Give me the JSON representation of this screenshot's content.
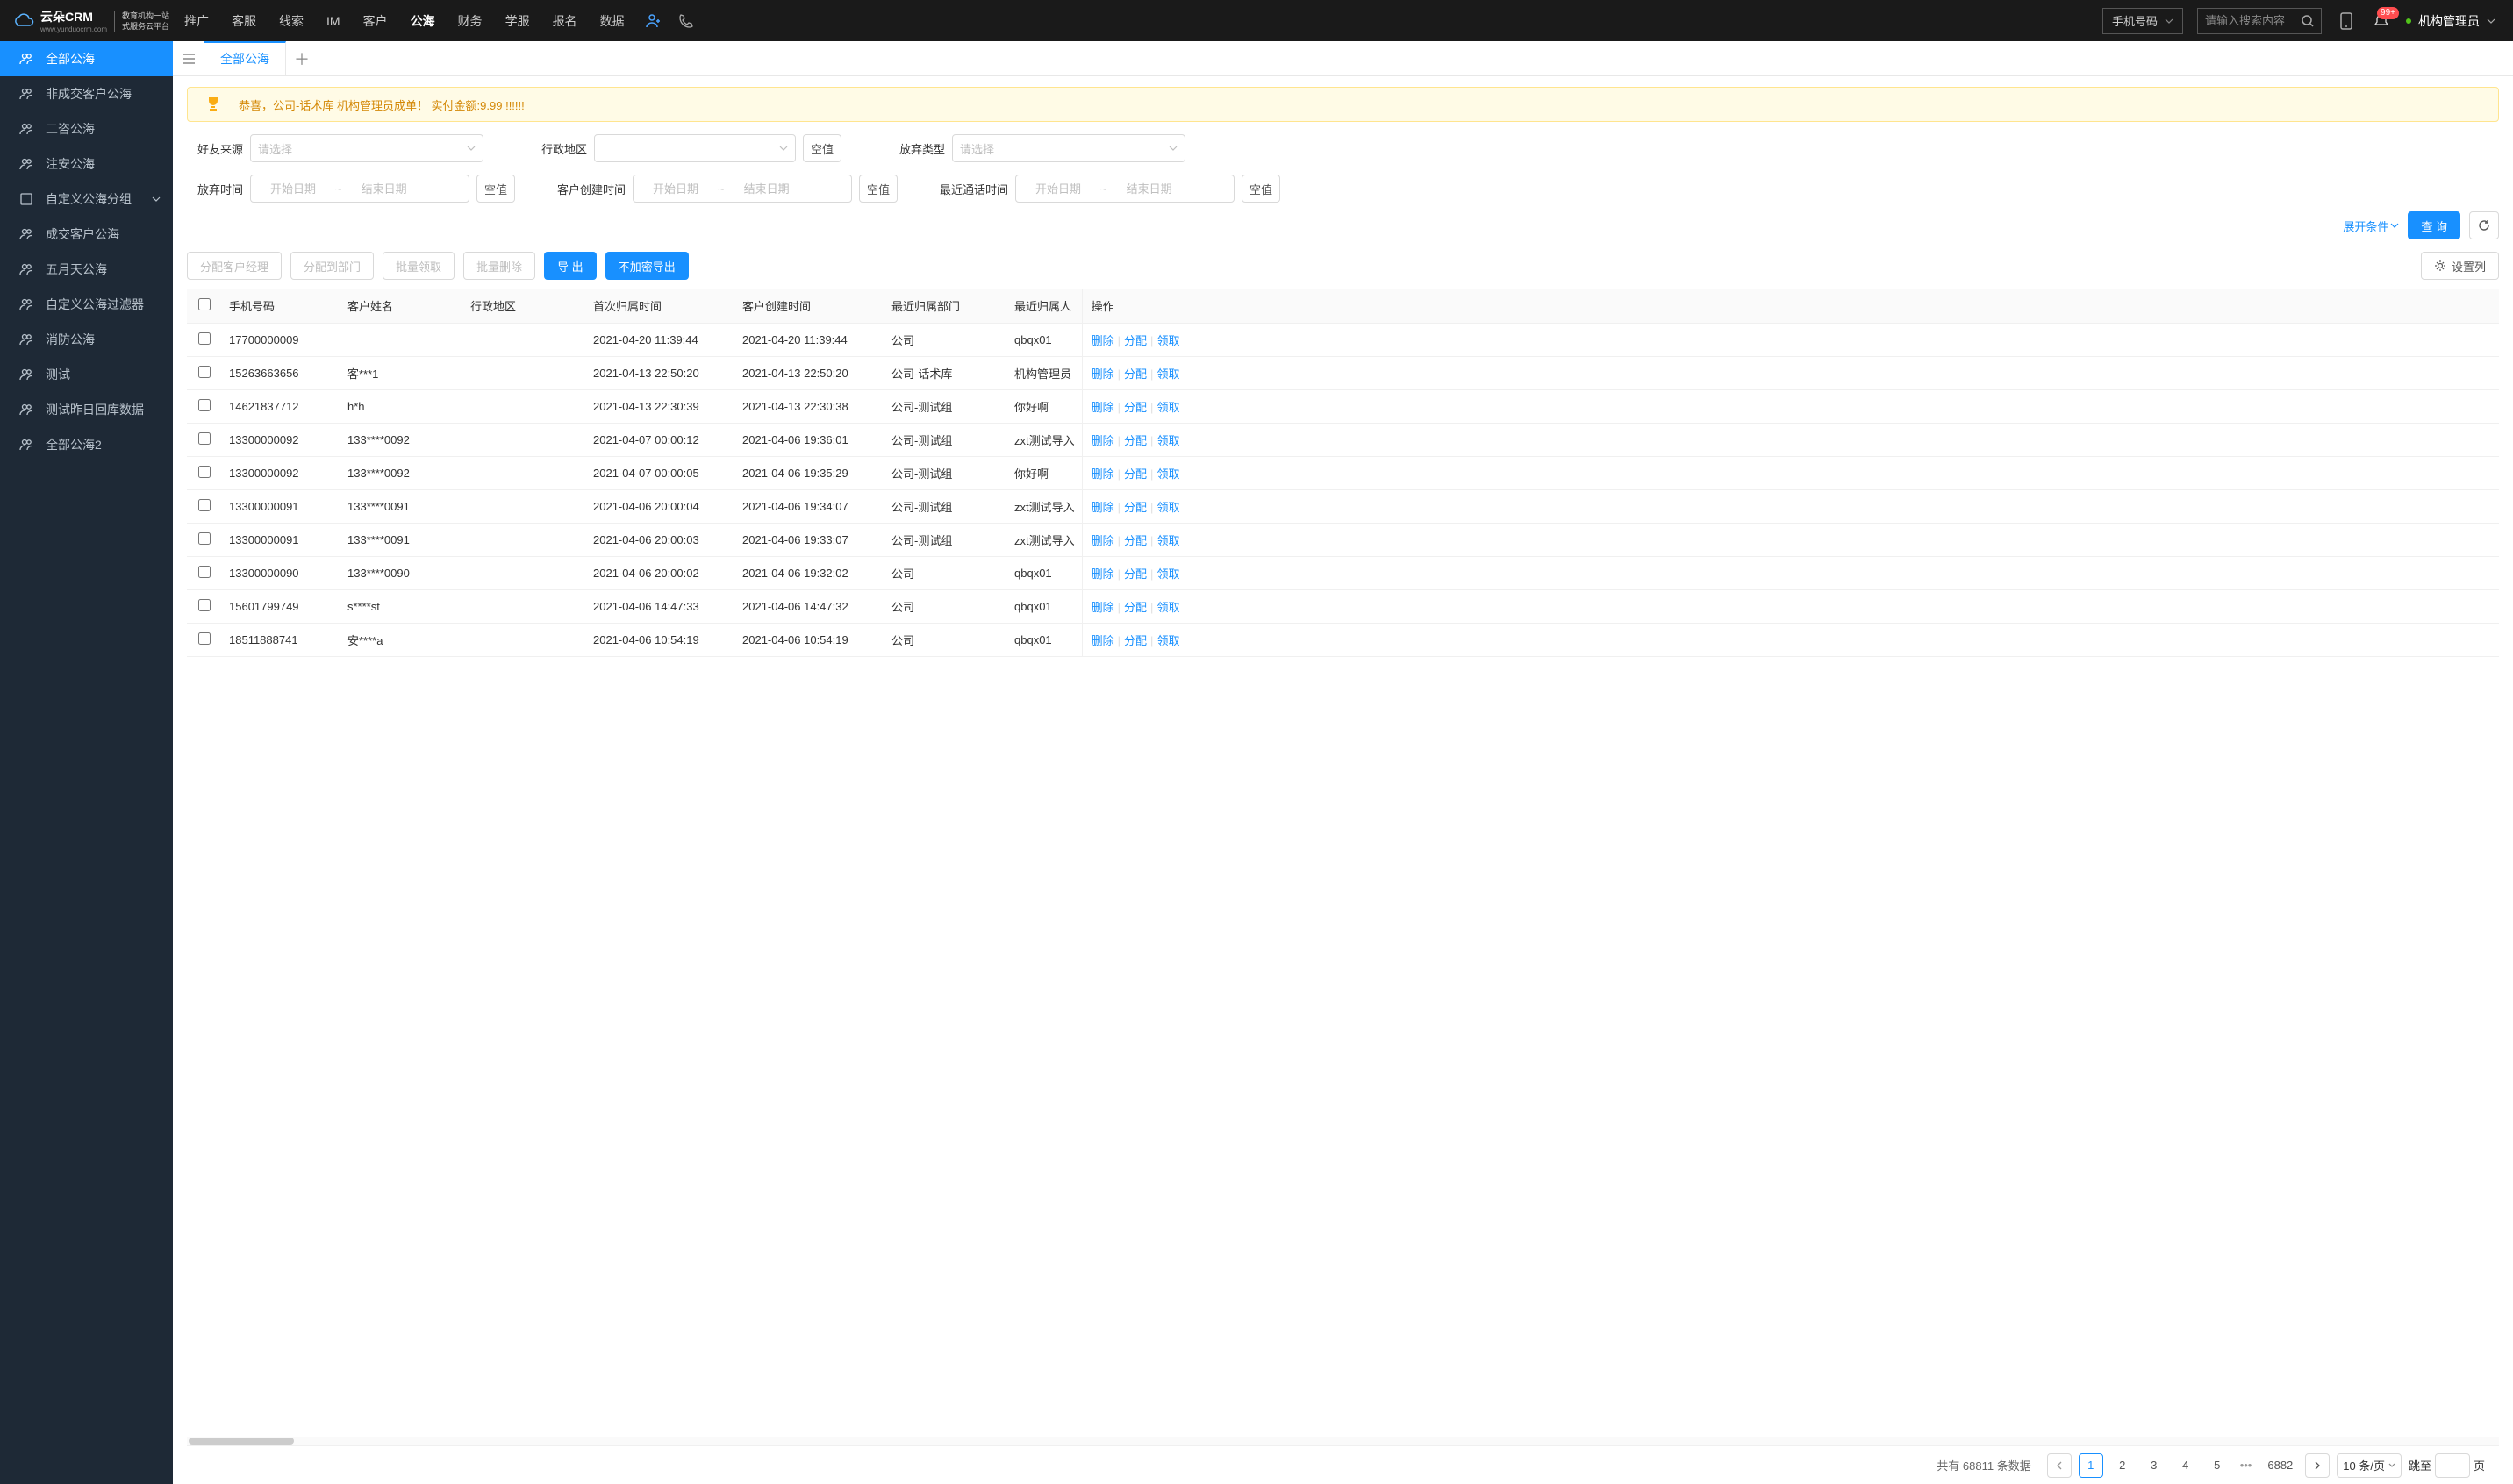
{
  "brand": {
    "name": "云朵CRM",
    "sub1": "教育机构一站",
    "sub2": "式服务云平台",
    "domain": "www.yunduocrm.com"
  },
  "nav": {
    "items": [
      "推广",
      "客服",
      "线索",
      "IM",
      "客户",
      "公海",
      "财务",
      "学服",
      "报名",
      "数据"
    ],
    "active": 5
  },
  "header": {
    "search_type": "手机号码",
    "search_placeholder": "请输入搜索内容",
    "badge": "99+",
    "user": "机构管理员"
  },
  "sidebar": {
    "items": [
      "全部公海",
      "非成交客户公海",
      "二咨公海",
      "注安公海",
      "自定义公海分组",
      "成交客户公海",
      "五月天公海",
      "自定义公海过滤器",
      "消防公海",
      "测试",
      "测试昨日回库数据",
      "全部公海2"
    ],
    "active": 0,
    "has_submenu": 4
  },
  "tabs": {
    "items": [
      "全部公海"
    ],
    "active": 0
  },
  "banner": "恭喜，公司-话术库  机构管理员成单！  实付金额:9.99 !!!!!!",
  "filters": {
    "source_label": "好友来源",
    "region_label": "行政地区",
    "abandon_type_label": "放弃类型",
    "abandon_time_label": "放弃时间",
    "create_time_label": "客户创建时间",
    "last_call_label": "最近通话时间",
    "placeholder_select": "请选择",
    "placeholder_start": "开始日期",
    "placeholder_end": "结束日期",
    "null_btn": "空值",
    "expand": "展开条件",
    "query": "查 询"
  },
  "toolbar": {
    "assign_manager": "分配客户经理",
    "assign_dept": "分配到部门",
    "batch_claim": "批量领取",
    "batch_delete": "批量删除",
    "export": "导 出",
    "export_plain": "不加密导出",
    "set_columns": "设置列"
  },
  "table": {
    "columns": [
      "手机号码",
      "客户姓名",
      "行政地区",
      "首次归属时间",
      "客户创建时间",
      "最近归属部门",
      "最近归属人",
      "操作"
    ],
    "action_labels": {
      "delete": "删除",
      "assign": "分配",
      "claim": "领取"
    },
    "rows": [
      {
        "phone": "17700000009",
        "name": "",
        "region": "",
        "first": "2021-04-20 11:39:44",
        "created": "2021-04-20 11:39:44",
        "dept": "公司",
        "owner": "qbqx01"
      },
      {
        "phone": "15263663656",
        "name": "客***1",
        "region": "",
        "first": "2021-04-13 22:50:20",
        "created": "2021-04-13 22:50:20",
        "dept": "公司-话术库",
        "owner": "机构管理员"
      },
      {
        "phone": "14621837712",
        "name": "h*h",
        "region": "",
        "first": "2021-04-13 22:30:39",
        "created": "2021-04-13 22:30:38",
        "dept": "公司-测试组",
        "owner": "你好啊"
      },
      {
        "phone": "13300000092",
        "name": "133****0092",
        "region": "",
        "first": "2021-04-07 00:00:12",
        "created": "2021-04-06 19:36:01",
        "dept": "公司-测试组",
        "owner": "zxt测试导入"
      },
      {
        "phone": "13300000092",
        "name": "133****0092",
        "region": "",
        "first": "2021-04-07 00:00:05",
        "created": "2021-04-06 19:35:29",
        "dept": "公司-测试组",
        "owner": "你好啊"
      },
      {
        "phone": "13300000091",
        "name": "133****0091",
        "region": "",
        "first": "2021-04-06 20:00:04",
        "created": "2021-04-06 19:34:07",
        "dept": "公司-测试组",
        "owner": "zxt测试导入"
      },
      {
        "phone": "13300000091",
        "name": "133****0091",
        "region": "",
        "first": "2021-04-06 20:00:03",
        "created": "2021-04-06 19:33:07",
        "dept": "公司-测试组",
        "owner": "zxt测试导入"
      },
      {
        "phone": "13300000090",
        "name": "133****0090",
        "region": "",
        "first": "2021-04-06 20:00:02",
        "created": "2021-04-06 19:32:02",
        "dept": "公司",
        "owner": "qbqx01"
      },
      {
        "phone": "15601799749",
        "name": "s****st",
        "region": "",
        "first": "2021-04-06 14:47:33",
        "created": "2021-04-06 14:47:32",
        "dept": "公司",
        "owner": "qbqx01"
      },
      {
        "phone": "18511888741",
        "name": "安****a",
        "region": "",
        "first": "2021-04-06 10:54:19",
        "created": "2021-04-06 10:54:19",
        "dept": "公司",
        "owner": "qbqx01"
      }
    ]
  },
  "pagination": {
    "total_label_prefix": "共有",
    "total": "68811",
    "total_label_suffix": "条数据",
    "pages": [
      "1",
      "2",
      "3",
      "4",
      "5"
    ],
    "last": "6882",
    "page_size": "10 条/页",
    "jump_prefix": "跳至",
    "jump_suffix": "页"
  }
}
